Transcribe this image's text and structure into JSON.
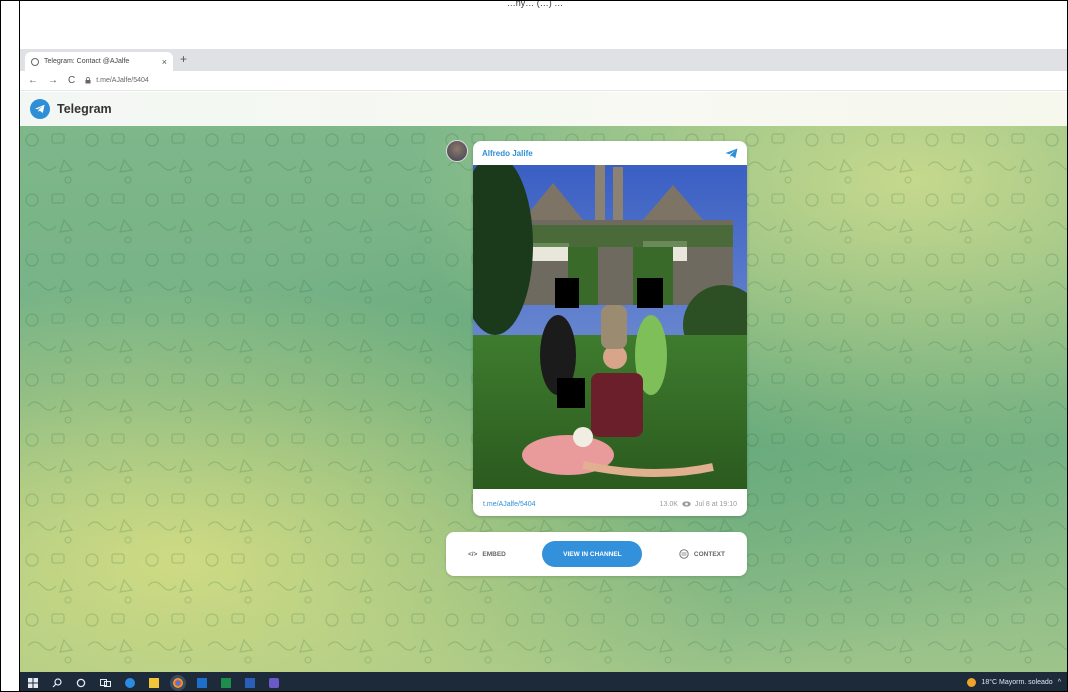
{
  "caption_top": "…ny… (…) …",
  "browser": {
    "tab_title": "Telegram: Contact @AJalfe",
    "tab_close": "×",
    "new_tab": "+",
    "back": "←",
    "forward": "→",
    "reload": "C",
    "url": "t.me/AJalfe/5404"
  },
  "telegram": {
    "brand": "Telegram",
    "accent_color": "#2f8fd6"
  },
  "post": {
    "author": "Alfredo Jalife",
    "link": "t.me/AJalfe/5404",
    "views": "13.0K",
    "date": "Jul 8 at 19:10"
  },
  "actions": {
    "embed": "EMBED",
    "view_in_channel": "VIEW IN CHANNEL",
    "context": "CONTEXT"
  },
  "taskbar": {
    "weather": "18°C  Mayorm. soleado",
    "tray_chevron": "^"
  }
}
